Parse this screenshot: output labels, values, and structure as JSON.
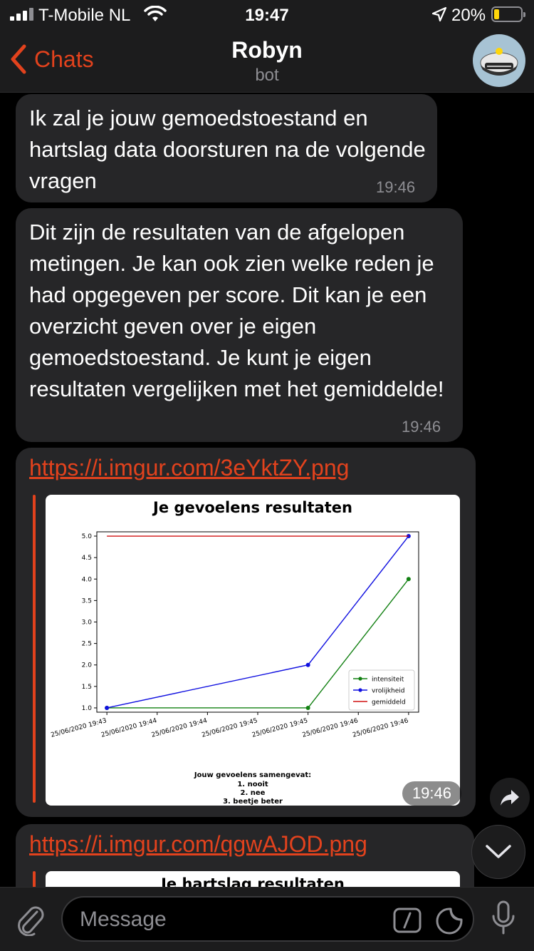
{
  "status": {
    "carrier": "T-Mobile NL",
    "time": "19:47",
    "battery": "20%"
  },
  "nav": {
    "back_label": "Chats",
    "title": "Robyn",
    "subtitle": "bot"
  },
  "messages": [
    {
      "text": "Ik zal je jouw gemoedstoestand en hartslag data doorsturen na de volgende vragen",
      "time": "19:46"
    },
    {
      "text": "Dit zijn de resultaten van de afgelopen metingen. Je kan ook zien welke reden je had opgegeven per score. Dit kan je een overzicht geven over je eigen gemoedstoestand. Je kunt je eigen resultaten vergelijken met het gemiddelde!",
      "time": "19:46"
    }
  ],
  "link1": {
    "url": "https://i.imgur.com/3eYktZY.png",
    "time": "19:46",
    "summary_title": "Jouw gevoelens samengevat:",
    "summary_items": [
      "1. nooit",
      "2. nee",
      "3. beetje beter"
    ]
  },
  "link2": {
    "url": "https://i.imgur.com/qgwAJOD.png",
    "preview_title": "Je hartslag resultaten"
  },
  "input": {
    "placeholder": "Message"
  },
  "colors": {
    "accent": "#e2421d",
    "bubble": "#262628",
    "intensiteit": "#128012",
    "vrolijkheid": "#1010e0",
    "gemiddeld": "#d01010"
  },
  "chart_data": {
    "type": "line",
    "title": "Je gevoelens resultaten",
    "x": [
      "25/06/2020 19:43",
      "25/06/2020 19:44",
      "25/06/2020 19:44",
      "25/06/2020 19:45",
      "25/06/2020 19:45",
      "25/06/2020 19:46",
      "25/06/2020 19:46"
    ],
    "ylim": [
      1.0,
      5.0
    ],
    "yticks": [
      "1.0",
      "1.5",
      "2.0",
      "2.5",
      "3.0",
      "3.5",
      "4.0",
      "4.5",
      "5.0"
    ],
    "legend_position": "bottom-right",
    "series": [
      {
        "name": "intensiteit",
        "points": [
          [
            0,
            1
          ],
          [
            2,
            1
          ],
          [
            3,
            4
          ]
        ],
        "markers": true
      },
      {
        "name": "vrolijkheid",
        "points": [
          [
            0,
            1
          ],
          [
            2,
            2
          ],
          [
            3,
            5
          ]
        ],
        "markers": true
      },
      {
        "name": "gemiddeld",
        "points": [
          [
            0,
            5
          ],
          [
            3,
            5
          ]
        ],
        "markers": false
      }
    ]
  }
}
